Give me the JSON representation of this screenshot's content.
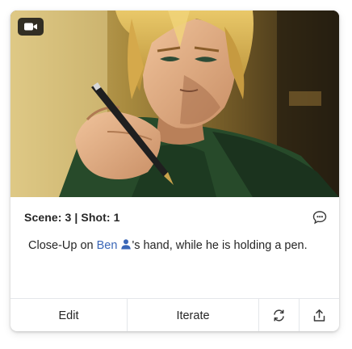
{
  "card": {
    "media_icon": "video-camera-icon",
    "scene_label": "Scene: 3",
    "separator": "|",
    "shot_label": "Shot: 1",
    "comment_icon": "comment-bubble-icon",
    "description": {
      "before": "Close-Up on ",
      "character": "Ben",
      "character_icon": "user-icon",
      "after": "'s hand, while he is holding a pen."
    },
    "actions": {
      "edit_label": "Edit",
      "iterate_label": "Iterate",
      "refresh_icon": "refresh-icon",
      "share_icon": "share-upload-icon"
    }
  },
  "colors": {
    "character_link": "#3b67b7",
    "text": "#262626",
    "divider": "#e4e6ea"
  }
}
